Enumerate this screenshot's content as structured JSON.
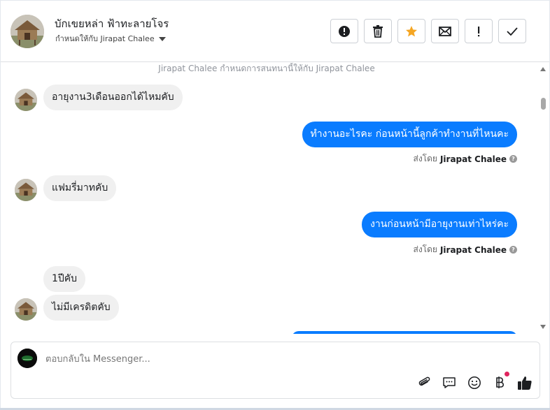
{
  "header": {
    "contact_name": "บักเขยหล่า ฟ้าทะลายโจร",
    "assigned_label": "กำหนดให้กับ Jirapat Chalee"
  },
  "toolbar": {
    "buttons": [
      {
        "name": "spam-button",
        "icon": "alert-circle-icon"
      },
      {
        "name": "delete-button",
        "icon": "trash-icon"
      },
      {
        "name": "star-button",
        "icon": "star-icon",
        "color": "#f5a623"
      },
      {
        "name": "mark-unread-button",
        "icon": "envelope-icon"
      },
      {
        "name": "follow-up-button",
        "icon": "exclamation-icon"
      },
      {
        "name": "mark-done-button",
        "icon": "check-icon"
      }
    ]
  },
  "conversation": {
    "system_note": "Jirapat Chalee กำหนดการสนทนานี้ให้กับ Jirapat Chalee",
    "messages": [
      {
        "direction": "in",
        "text": "อายุงาน3เดือนออกได้ไหมคับ"
      },
      {
        "direction": "out",
        "text": "ทำงานอะไรคะ ก่อนหน้านี้ลูกค้าทำงานที่ไหนคะ"
      },
      {
        "direction": "in",
        "text": "แฟมรี่มาทคับ"
      },
      {
        "direction": "out",
        "text": "งานก่อนหน้ามีอายุงานเท่าไหร่คะ"
      },
      {
        "direction": "in",
        "text": "1ปีคับ"
      },
      {
        "direction": "in",
        "text": "ไม่มีเครดิตคับ"
      }
    ],
    "sent_by_prefix": "ส่งโดย",
    "sent_by_name": "Jirapat Chalee"
  },
  "composer": {
    "placeholder": "ตอบกลับใน Messenger...",
    "value": "",
    "icons": [
      "paperclip-icon",
      "saved-replies-icon",
      "emoji-icon",
      "baht-payment-icon",
      "thumbs-up-icon"
    ]
  },
  "colors": {
    "accent_blue": "#0a7cff",
    "incoming_bubble": "#f0f0f0",
    "star": "#f5a623",
    "notify_dot": "#e0245e"
  }
}
